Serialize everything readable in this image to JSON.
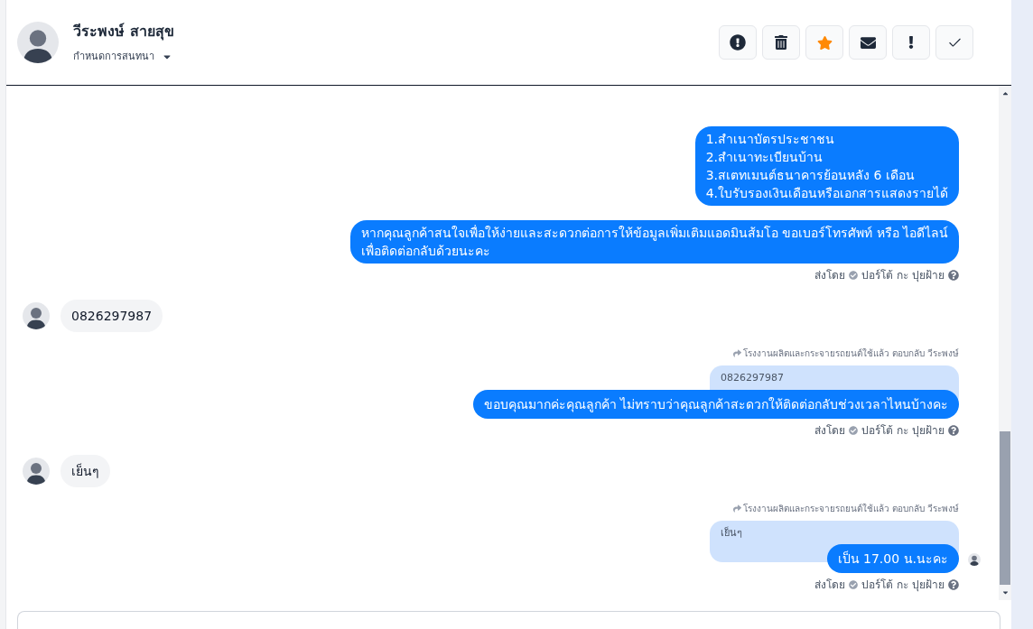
{
  "header": {
    "name": "วีระพงษ์ สายสุข",
    "assign_label": "กำหนดการสนทนา",
    "actions": [
      {
        "kind": "alert",
        "active": false
      },
      {
        "kind": "trash",
        "active": false
      },
      {
        "kind": "star",
        "active": true
      },
      {
        "kind": "mail",
        "active": false
      },
      {
        "kind": "bang",
        "active": false
      },
      {
        "kind": "check",
        "active": false
      }
    ]
  },
  "messages": [
    {
      "kind": "outgoing",
      "lines": [
        "1.สำเนาบัตรประชาชน",
        "2.สำเนาทะเบียนบ้าน",
        "3.สเตทเมนต์ธนาคารย้อนหลัง 6 เดือน",
        "4.ใบรับรองเงินเดือนหรือเอกสารแสดงรายได้"
      ]
    },
    {
      "kind": "outgoing",
      "lines": [
        "หากคุณลูกค้าสนใจเพื่อให้ง่ายและสะดวกต่อการให้ข้อมูลเพิ่มเติมแอดมินส้มโอ ขอเบอร์โทรศัพท์ หรือ ไอดีไลน์",
        "เพื่อติดต่อกลับด้วยนะคะ"
      ],
      "sent_by": "ส่งโดย",
      "agent": "ปอร์โต้ กะ ปุยฝ้าย"
    },
    {
      "kind": "incoming",
      "lines": [
        "0826297987"
      ]
    },
    {
      "kind": "reply",
      "reply_note": "โรงงานผลิตและกระจายรถยนต์ใช้แล้ว ตอบกลับ วีระพงษ์",
      "quoted": "0826297987",
      "lines": [
        "ขอบคุณมากค่ะคุณลูกค้า ไม่ทราบว่าคุณลูกค้าสะดวกให้ติดต่อกลับช่วงเวลาไหนบ้างคะ"
      ],
      "sent_by": "ส่งโดย",
      "agent": "ปอร์โต้ กะ ปุยฝ้าย",
      "seen": false
    },
    {
      "kind": "incoming",
      "lines": [
        "เย็นๆ"
      ]
    },
    {
      "kind": "reply",
      "reply_note": "โรงงานผลิตและกระจายรถยนต์ใช้แล้ว ตอบกลับ วีระพงษ์",
      "quoted": "เย็นๆ",
      "lines": [
        "เป็น 17.00 น.นะคะ"
      ],
      "sent_by": "ส่งโดย",
      "agent": "ปอร์โต้ กะ ปุยฝ้าย",
      "seen": true
    }
  ]
}
